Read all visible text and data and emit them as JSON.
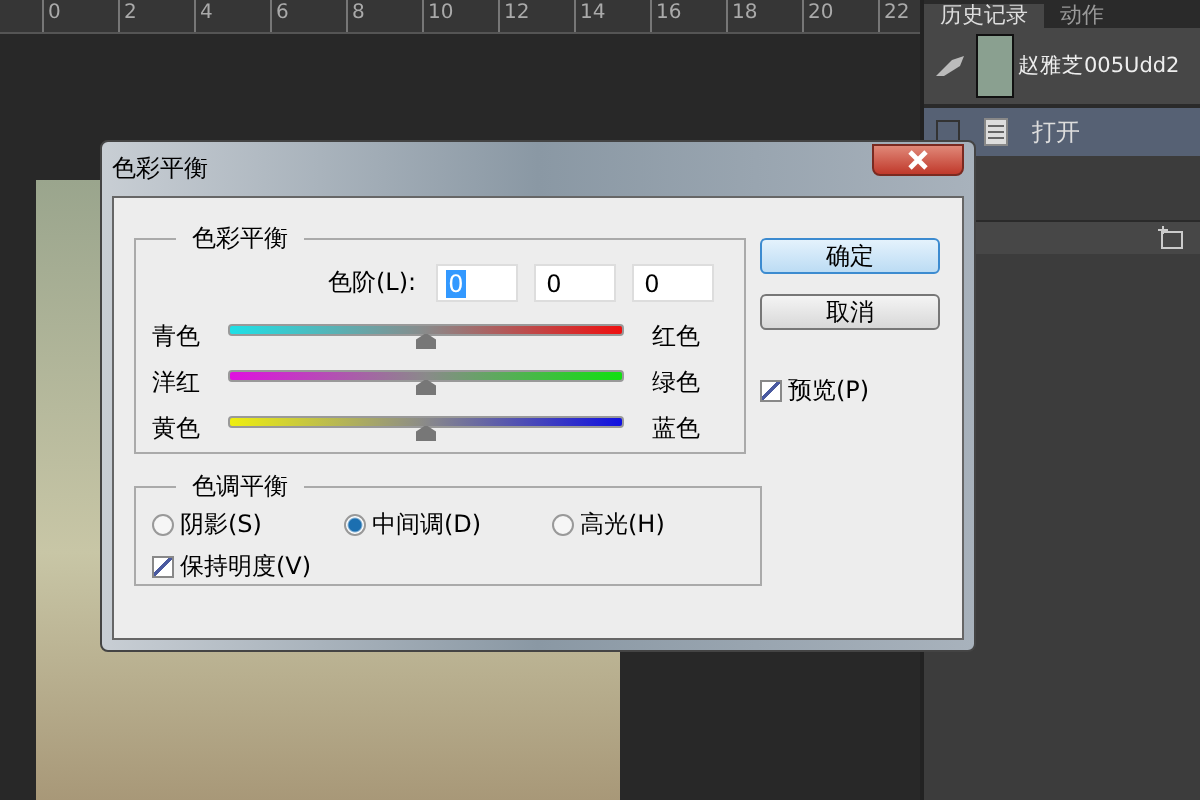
{
  "ruler": {
    "ticks": [
      "0",
      "2",
      "4",
      "6",
      "8",
      "10",
      "12",
      "14",
      "16",
      "18",
      "20",
      "22"
    ]
  },
  "panel": {
    "tabs": [
      {
        "label": "历史记录",
        "selected": true
      },
      {
        "label": "动作",
        "selected": false
      }
    ],
    "snapshot": {
      "label": "赵雅芝005Udd2"
    },
    "history": [
      {
        "label": "打开",
        "selected": true
      }
    ]
  },
  "dialog": {
    "title": "色彩平衡",
    "color_group": {
      "title": "色彩平衡",
      "levels_label": "色阶(L):",
      "levels": [
        {
          "value": "0",
          "selected": true
        },
        {
          "value": "0",
          "selected": false
        },
        {
          "value": "0",
          "selected": false
        }
      ],
      "sliders": [
        {
          "left": "青色",
          "right": "红色",
          "level": 0.5
        },
        {
          "left": "洋红",
          "right": "绿色",
          "level": 0.5
        },
        {
          "left": "黄色",
          "right": "蓝色",
          "level": 0.5
        }
      ]
    },
    "tone_group": {
      "title": "色调平衡",
      "radios": [
        {
          "label": "阴影(S)",
          "selected": false
        },
        {
          "label": "中间调(D)",
          "selected": true
        },
        {
          "label": "高光(H)",
          "selected": false
        }
      ],
      "preserve": {
        "label": "保持明度(V)",
        "checked": true
      }
    },
    "buttons": [
      {
        "label": "确定",
        "default": true
      },
      {
        "label": "取消",
        "default": false
      }
    ],
    "preview": {
      "label": "预览(P)",
      "checked": true
    }
  }
}
